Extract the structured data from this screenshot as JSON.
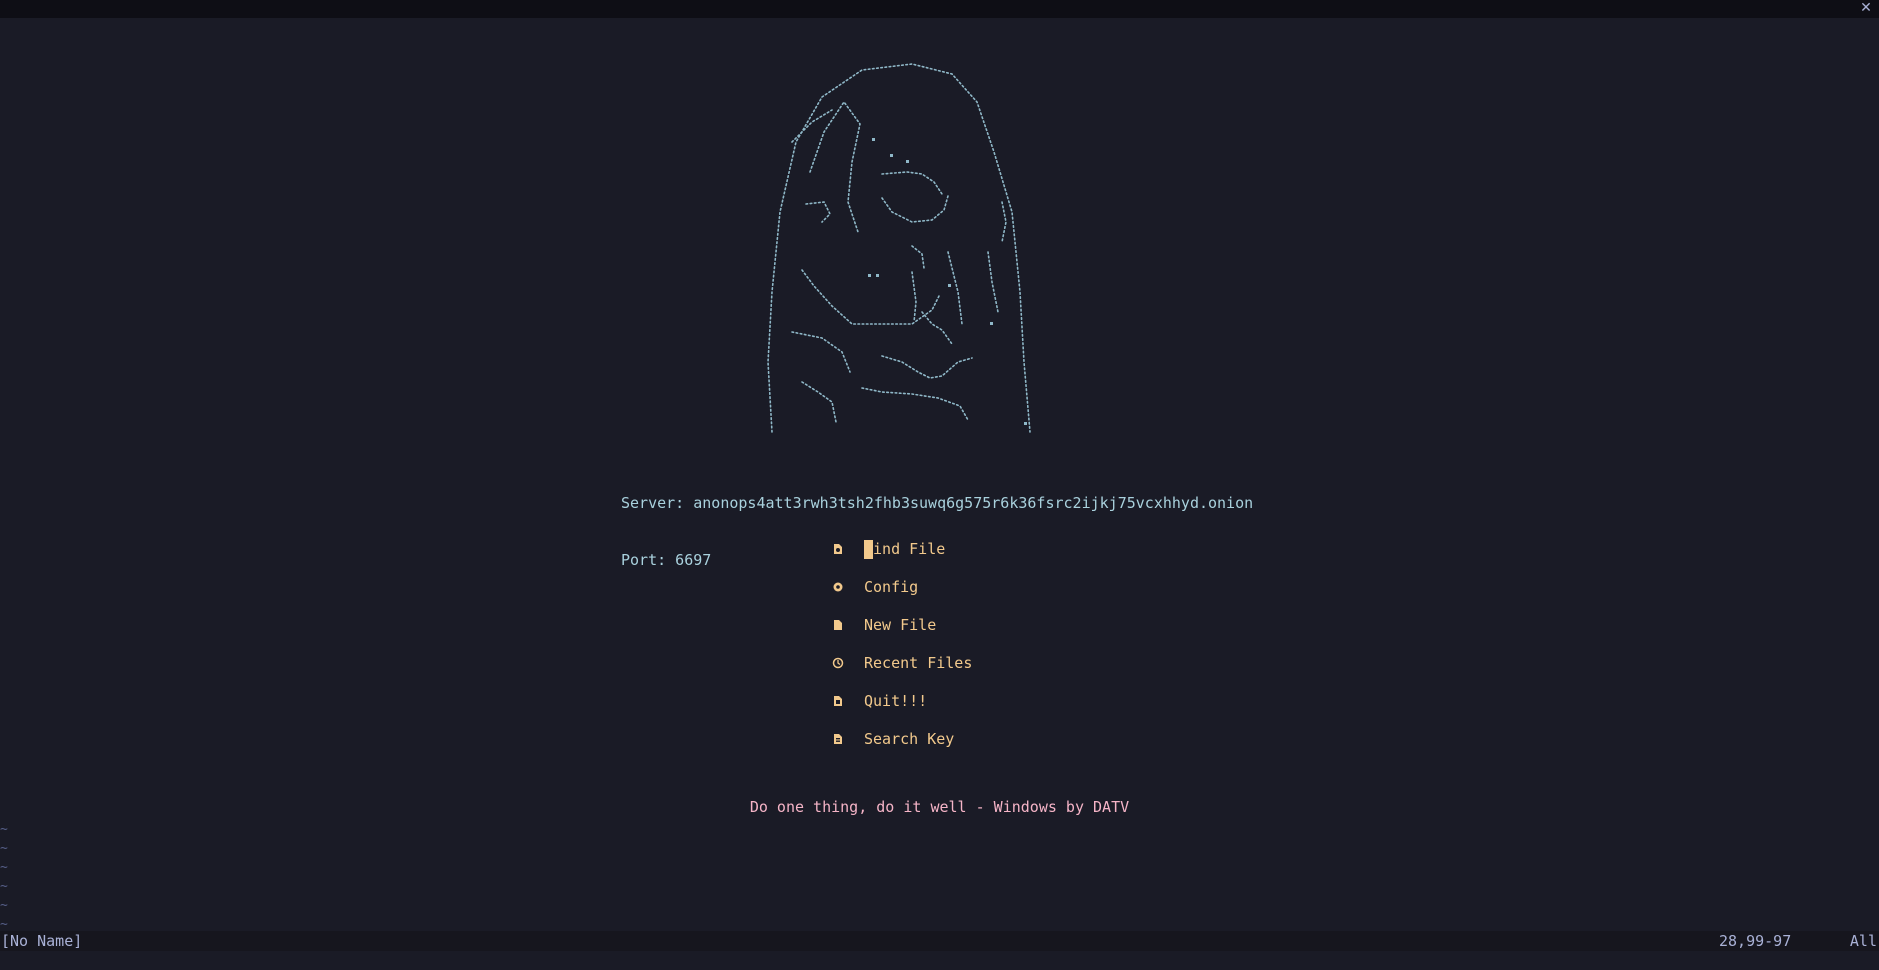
{
  "window": {
    "close_icon": "close-icon"
  },
  "dashboard": {
    "server_line": "Server: anonops4att3rwh3tsh2fhb3suwq6g575r6k36fsrc2ijkj75vcxhhyd.onion",
    "port_line": "Port: 6697",
    "menu": [
      {
        "label": "Find File",
        "icon": "file-search-icon"
      },
      {
        "label": "Config",
        "icon": "gear-icon"
      },
      {
        "label": "New File",
        "icon": "new-file-icon"
      },
      {
        "label": "Recent Files",
        "icon": "history-icon"
      },
      {
        "label": "Quit!!!",
        "icon": "quit-icon"
      },
      {
        "label": "Search Key",
        "icon": "search-key-icon"
      }
    ],
    "footer": "Do one thing, do it well - Windows by DATV"
  },
  "buffer": {
    "tilde": "~"
  },
  "statusline": {
    "buffer_name": "[No Name]",
    "position": "28,99-97",
    "scroll": "All"
  },
  "colors": {
    "background": "#1a1b26",
    "accent": "#f2c98c",
    "server_text": "#a9d1dd",
    "footer_text": "#f5b4c7",
    "art": "#8fb8c8"
  }
}
